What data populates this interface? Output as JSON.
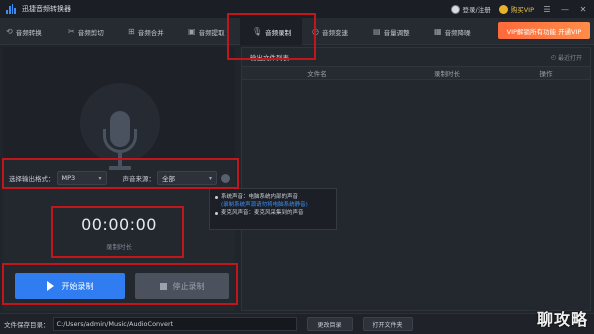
{
  "app": {
    "title": "迅捷音频转换器",
    "login_label": "登录/注册",
    "vip_label": "购买VIP",
    "window_controls": [
      "☰",
      "—",
      "✕"
    ]
  },
  "tabs": [
    {
      "label": "音频转换",
      "icon": "convert-icon"
    },
    {
      "label": "音频剪切",
      "icon": "scissors-icon"
    },
    {
      "label": "音频合并",
      "icon": "merge-icon"
    },
    {
      "label": "音频提取",
      "icon": "extract-icon"
    },
    {
      "label": "音频录制",
      "icon": "mic-icon",
      "active": true
    },
    {
      "label": "音频变速",
      "icon": "speed-icon"
    },
    {
      "label": "音量调整",
      "icon": "volume-icon"
    },
    {
      "label": "音频降噪",
      "icon": "denoise-icon"
    }
  ],
  "vip_banner": "VIP解锁所有功能 开通VIP",
  "record": {
    "format_label": "选择输出格式：",
    "format_value": "MP3",
    "source_label": "声音来源：",
    "source_value": "全部",
    "time_value": "00:00:00",
    "time_label": "录制时长",
    "start_label": "开始录制",
    "stop_label": "停止录制"
  },
  "popup": {
    "line1": "系统声音：电脑系统内部的声音",
    "line2": "(录制系统声源请勿将电脑系统静音)",
    "line3": "麦克风声音：麦克风采集到的声音"
  },
  "list": {
    "title": "输出文件列表",
    "link": "最近打开",
    "headers": [
      "文件名",
      "录制时长",
      "操作"
    ]
  },
  "bottom": {
    "dir_label": "文件保存目录：",
    "dir_value": "C:/Users/admin/Music/AudioConvert",
    "change_label": "更改目录",
    "open_label": "打开文件夹"
  },
  "watermark": "聊攻略",
  "colors": {
    "accent": "#2f7df0",
    "annotation": "#c0161c",
    "vip_banner": "#ff6a3a"
  }
}
